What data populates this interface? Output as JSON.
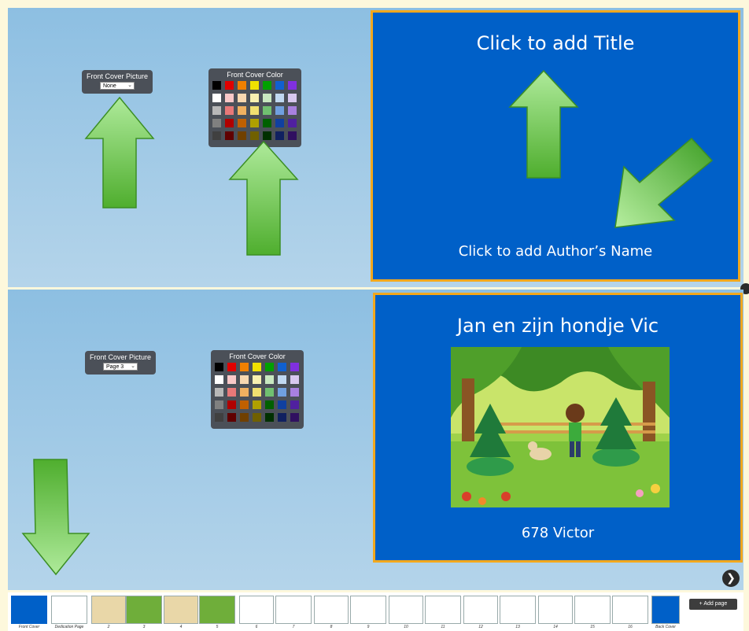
{
  "top_editor": {
    "picture_widget": {
      "title": "Front Cover Picture",
      "selected": "None"
    },
    "color_widget": {
      "title": "Front Cover Color"
    },
    "cover": {
      "title": "Click to add Title",
      "author": "Click to add Author’s Name"
    }
  },
  "bottom_editor": {
    "picture_widget": {
      "title": "Front Cover Picture",
      "selected": "Page 3"
    },
    "color_widget": {
      "title": "Front Cover Color"
    },
    "cover": {
      "title": "Jan en zijn hondje Vic",
      "author": "678 Victor"
    }
  },
  "palette": [
    [
      "#000000",
      "#e00000",
      "#f08000",
      "#f0e000",
      "#00a000",
      "#1060d0",
      "#8030e0"
    ],
    [
      "#ffffff",
      "#f8c8c8",
      "#f8d8b0",
      "#f8f0b0",
      "#c8e8c0",
      "#c0d8f0",
      "#d8c8f0"
    ],
    [
      "#b8b8b8",
      "#e87878",
      "#f0b060",
      "#f0e070",
      "#70c070",
      "#70a0e0",
      "#a880e0"
    ],
    [
      "#808080",
      "#b00000",
      "#c06000",
      "#b0a000",
      "#006000",
      "#1040a0",
      "#5020a0"
    ],
    [
      "#404040",
      "#600000",
      "#704000",
      "#706000",
      "#003000",
      "#102060",
      "#301060"
    ]
  ],
  "page_strip": {
    "thumbs": [
      {
        "label": "Front Cover"
      },
      {
        "label": "Dedication Page"
      },
      {
        "label": "2"
      },
      {
        "label": "3"
      },
      {
        "label": "4"
      },
      {
        "label": "5"
      },
      {
        "label": "6"
      },
      {
        "label": "7"
      },
      {
        "label": "8"
      },
      {
        "label": "9"
      },
      {
        "label": "10"
      },
      {
        "label": "11"
      },
      {
        "label": "12"
      },
      {
        "label": "13"
      },
      {
        "label": "14"
      },
      {
        "label": "15"
      },
      {
        "label": "16"
      },
      {
        "label": "Back Cover"
      }
    ],
    "add_page_label": "Add page",
    "add_page_icon": "+"
  },
  "icons": {
    "next": "❯"
  },
  "colors": {
    "cover_blue": "#0060c8",
    "cover_border": "#f2a81d",
    "arrow_green": "#5fbf3a"
  }
}
